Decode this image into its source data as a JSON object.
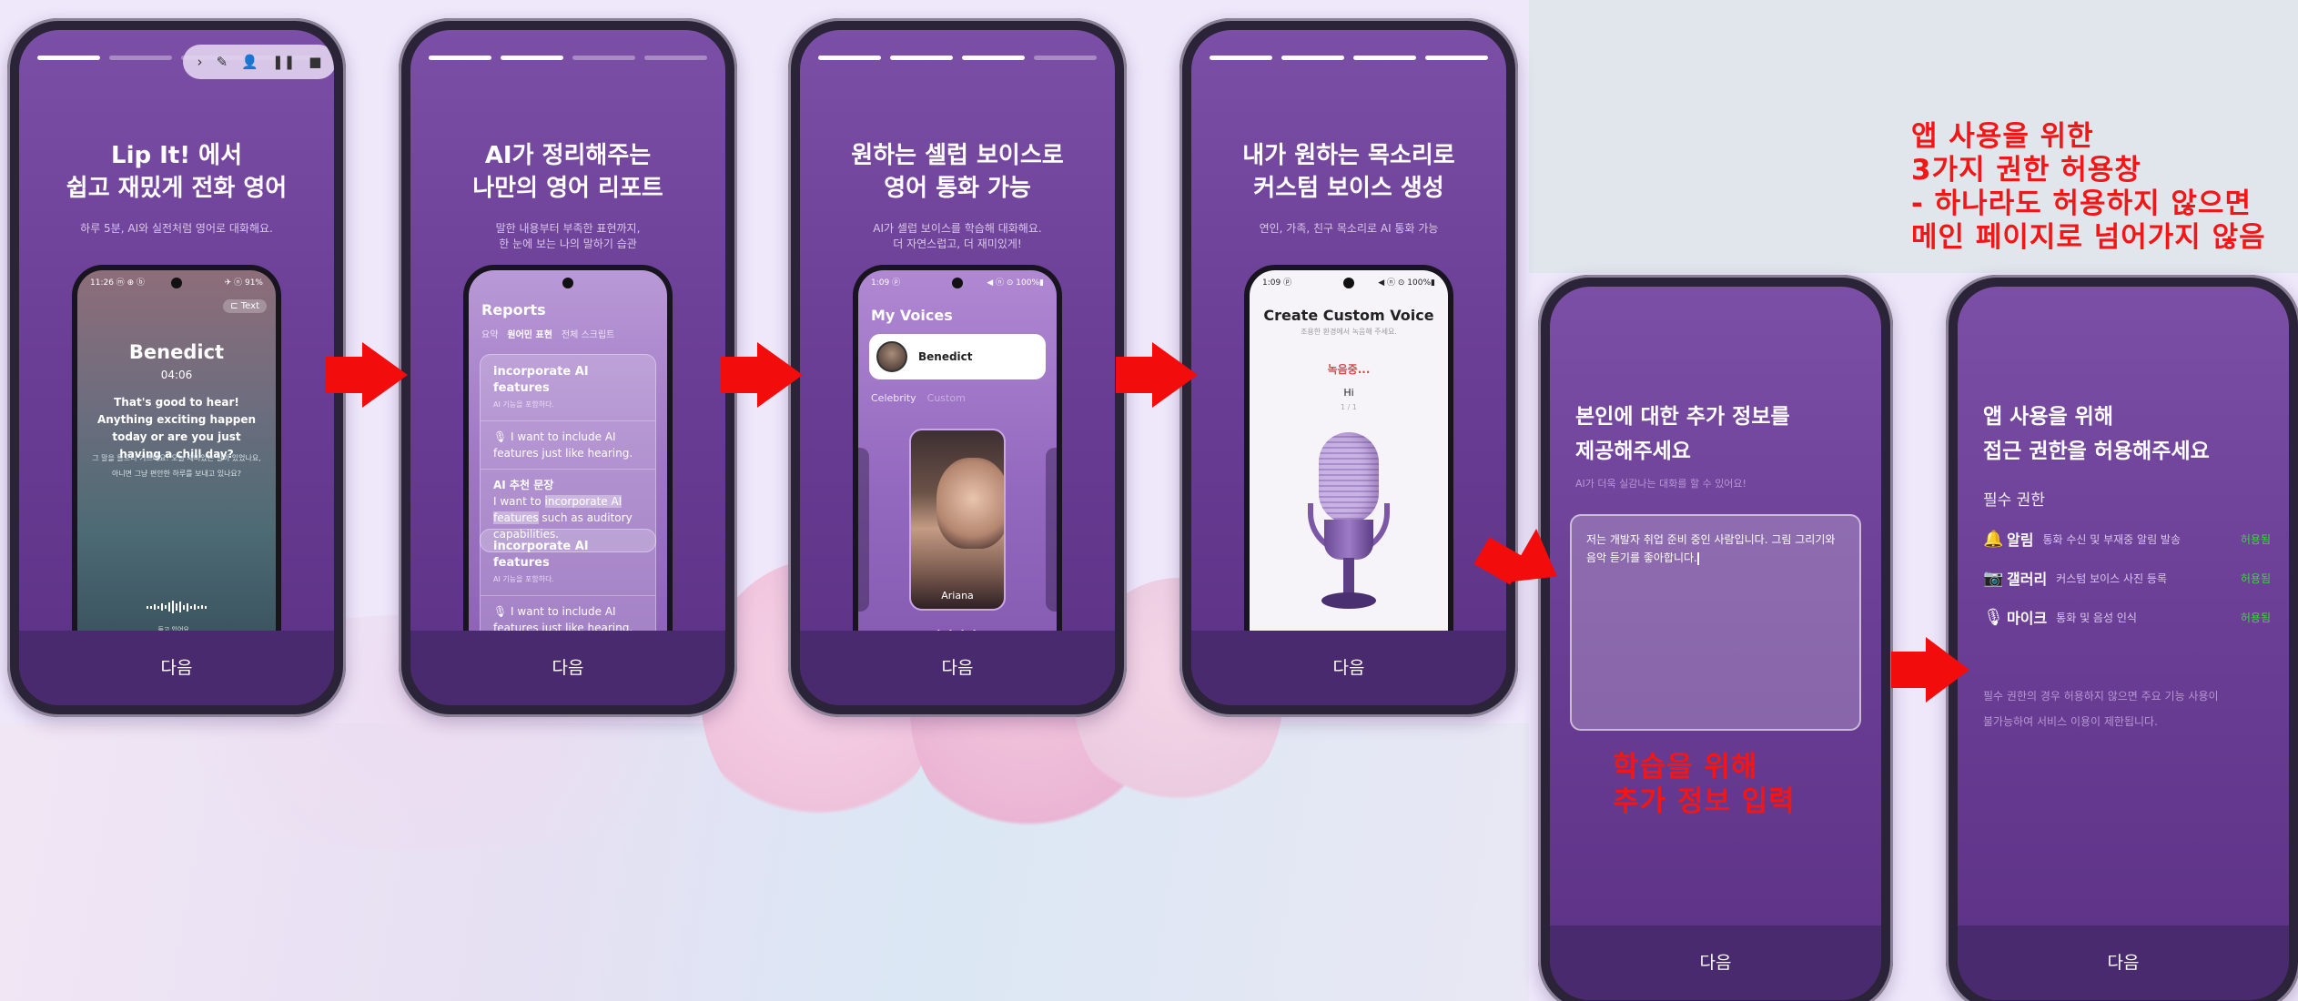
{
  "next": "다음",
  "s1": {
    "title1": "Lip It! 에서",
    "title2": "쉽고 재밌게 전화 영어",
    "sub": "하루 5분, AI와 실전처럼 영어로 대화해요.",
    "toolbar": {
      "arrow": "›",
      "pen": "✎",
      "person": "👤",
      "pause": "❚❚",
      "stop": "■"
    },
    "status": "11:26 ⓜ ⊕ ⓑ",
    "status_r": "✈ ⓝ 91%",
    "text_btn": "⊏ Text",
    "name": "Benedict",
    "time": "04:06",
    "msg": "That's good to hear! Anything exciting happen today or are you just having a chill day?",
    "msg_ko1": "그 말을 들으니 기쁘네요! 오늘 재미있는 일이 있었나요,",
    "msg_ko2": "아니면 그냥 편안한 하루를 보내고 있나요?",
    "listening": "듣고 있어요..."
  },
  "s2": {
    "title1": "AI가 정리해주는",
    "title2": "나만의 영어 리포트",
    "sub1": "말한 내용부터 부족한 표현까지,",
    "sub2": "한 눈에 보는 나의 말하기 습관",
    "heading": "Reports",
    "tabs": [
      "요약",
      "원어민 표현",
      "전체 스크립트"
    ],
    "card_title": "incorporate AI features",
    "card_sub": "AI 기능을 포함하다.",
    "said": "🎙 I want to include AI features just like hearing.",
    "rec": "AI 추천 문장",
    "rec_a": "I want to ",
    "rec_b": "incorporate AI features",
    "rec_c": " such as auditory capabilities."
  },
  "s3": {
    "title1": "원하는 셀럽 보이스로",
    "title2": "영어 통화 가능",
    "sub1": "AI가 셀럽 보이스를 학습해 대화해요.",
    "sub2": "더 자연스럽고, 더 재미있게!",
    "status": "1:09 ⓟ",
    "status_r": "◀ ⓝ ⊙ 100%▮",
    "heading": "My Voices",
    "voice": "Benedict",
    "tab_a": "Celebrity",
    "tab_b": "Custom",
    "celeb": "Ariana",
    "dots": "•  • • •"
  },
  "s4": {
    "title1": "내가 원하는 목소리로",
    "title2": "커스텀 보이스 생성",
    "sub": "연인, 가족, 친구 목소리로 AI 통화 가능",
    "status": "1:09 ⓟ",
    "status_r": "◀ ⓝ ⊙ 100%▮",
    "heading": "Create Custom Voice",
    "hint": "조용한 환경에서 녹음해 주세요.",
    "rec": "녹음중...",
    "word": "Hi",
    "count": "1 / 1"
  },
  "s5": {
    "title1": "본인에 대한 추가 정보를",
    "title2": "제공해주세요",
    "sub": "AI가 더욱 실감나는 대화를 할 수 있어요!",
    "input": "저는 개발자 취업 준비 중인 사람입니다. 그림 그리기와 음악 듣기를 좋아합니다."
  },
  "s6": {
    "title1": "앱 사용을 위해",
    "title2": "접근 권한을 허용해주세요",
    "req": "필수 권한",
    "perms": [
      {
        "icon": "🔔",
        "name": "알림",
        "desc": "통화 수신 및 부재중 알림 발송",
        "ok": "허용됨"
      },
      {
        "icon": "📷",
        "name": "갤러리",
        "desc": "커스텀 보이스 사진 등록",
        "ok": "허용됨"
      },
      {
        "icon": "🎙",
        "name": "마이크",
        "desc": "통화 및 음성 인식",
        "ok": "허용됨"
      }
    ],
    "note1": "필수 권한의 경우 허용하지 않으면 주요 기능 사용이",
    "note2": "불가능하여 서비스 이용이 제한됩니다."
  },
  "annot1": {
    "l1": "앱 사용을 위한",
    "l2": "3가지 권한 허용창",
    "l3": "- 하나라도 허용하지 않으면",
    "l4": "메인 페이지로 넘어가지 않음"
  },
  "annot2": {
    "l1": "학습을 위해",
    "l2": "추가 정보 입력"
  },
  "colors": {
    "accent": "#6c3f96",
    "annotation": "#f21616",
    "arrow": "#f20c0c",
    "allowed": "#38d838"
  }
}
